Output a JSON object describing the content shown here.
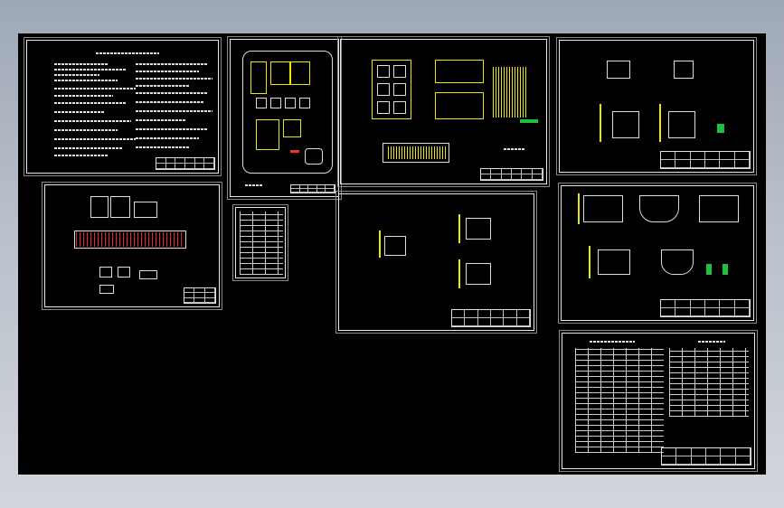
{
  "canvas": {
    "background": "#000000",
    "line_color": "#ffffff",
    "accent_yellow": "#f2e600",
    "accent_green": "#1fbf3f",
    "accent_red": "#e33333"
  },
  "sheets": [
    {
      "id": "notes-sheet",
      "title_block_text": ""
    },
    {
      "id": "site-plan-sheet",
      "title_block_text": ""
    },
    {
      "id": "tank-plan-sheet",
      "title_block_text": ""
    },
    {
      "id": "detail-sheet-1",
      "title_block_text": ""
    },
    {
      "id": "process-flow-sheet",
      "title_block_text": ""
    },
    {
      "id": "index-table-sheet",
      "title_block_text": ""
    },
    {
      "id": "section-sheet",
      "title_block_text": ""
    },
    {
      "id": "detail-sheet-2",
      "title_block_text": ""
    },
    {
      "id": "equipment-list-sheet",
      "title_block_text": ""
    }
  ]
}
